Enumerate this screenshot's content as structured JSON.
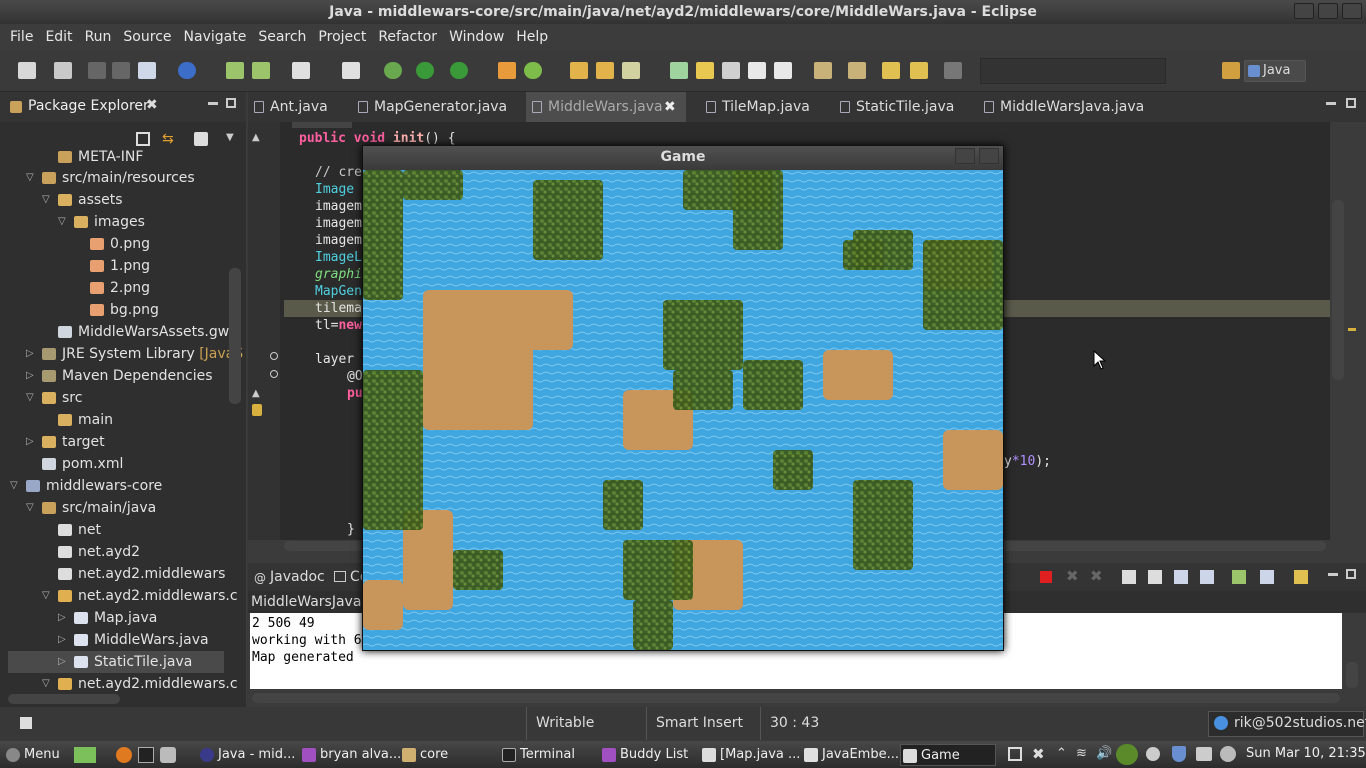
{
  "window": {
    "title": "Java - middlewars-core/src/main/java/net/ayd2/middlewars/core/MiddleWars.java - Eclipse"
  },
  "menu": [
    "File",
    "Edit",
    "Run",
    "Source",
    "Navigate",
    "Search",
    "Project",
    "Refactor",
    "Window",
    "Help"
  ],
  "perspective": {
    "label": "Java"
  },
  "package_explorer": {
    "title": "Package Explorer",
    "items": [
      {
        "label": "META-INF"
      },
      {
        "label": "src/main/resources"
      },
      {
        "label": "assets"
      },
      {
        "label": "images"
      },
      {
        "label": "0.png"
      },
      {
        "label": "1.png"
      },
      {
        "label": "2.png"
      },
      {
        "label": "bg.png"
      },
      {
        "label": "MiddleWarsAssets.gwt"
      },
      {
        "label": "JRE System Library",
        "suffix": "[JavaS"
      },
      {
        "label": "Maven Dependencies"
      },
      {
        "label": "src"
      },
      {
        "label": "main"
      },
      {
        "label": "target"
      },
      {
        "label": "pom.xml"
      },
      {
        "label": "middlewars-core"
      },
      {
        "label": "src/main/java"
      },
      {
        "label": "net"
      },
      {
        "label": "net.ayd2"
      },
      {
        "label": "net.ayd2.middlewars"
      },
      {
        "label": "net.ayd2.middlewars.c"
      },
      {
        "label": "Map.java"
      },
      {
        "label": "MiddleWars.java"
      },
      {
        "label": "StaticTile.java"
      },
      {
        "label": "net.ayd2.middlewars.c"
      }
    ]
  },
  "editor_tabs": [
    "Ant.java",
    "MapGenerator.java",
    "MiddleWars.java",
    "TileMap.java",
    "StaticTile.java",
    "MiddleWarsJava.java"
  ],
  "code": {
    "l1_kw": "public void",
    "l1_fn": "init",
    "l1_rest": "() {",
    "l2": "// cre",
    "l3": "Image",
    "l4": "imagem",
    "l5": "imagem",
    "l6": "imagem",
    "l7": "ImageL",
    "l8": "graphi",
    "l9": "MapGene",
    "l10": "tilema",
    "l11a": "tl=",
    "l11b": "new",
    "l12": "layer",
    "l13": "@O",
    "l14": "pu",
    "l15a": "y",
    "l15b": "*10",
    "l15c": ");",
    "l16": "}"
  },
  "bottom_tabs": {
    "javadoc": "Javadoc",
    "console": "Co"
  },
  "console": {
    "title": "MiddleWarsJava [",
    "lines": [
      "2 506 49",
      "working with 6",
      "Map generated"
    ]
  },
  "game_window": {
    "title": "Game"
  },
  "status": {
    "writable": "Writable",
    "insert_mode": "Smart Insert",
    "position": "30 : 43",
    "account": "rik@502studios.net"
  },
  "taskbar": {
    "menu": "Menu",
    "tasks": [
      "Java - mid...",
      "bryan alva...",
      "core",
      "Terminal",
      "Buddy List",
      "[Map.java ...",
      "JavaEmbe...",
      "Game"
    ],
    "clock": "Sun Mar 10, 21:35"
  },
  "colors": {
    "water": "#3fa6e0",
    "land": "#c8955a",
    "forest": "#3c5a1c",
    "accent_tab": "#4d4d4d"
  }
}
